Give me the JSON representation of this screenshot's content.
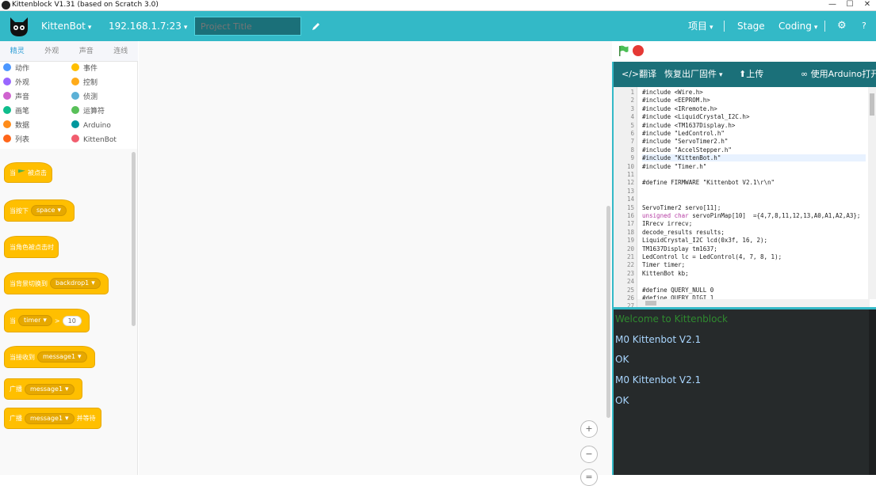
{
  "window": {
    "title": "Kittenblock V1.31 (based on Scratch 3.0)",
    "min": "—",
    "max": "☐",
    "close": "✕"
  },
  "menubar": {
    "brand": "KittenBot",
    "ip": "192.168.1.7:23",
    "project_placeholder": "Project Title",
    "project_menu": "项目",
    "stage": "Stage",
    "coding": "Coding",
    "settings_glyph": "⚙",
    "help_glyph": "?"
  },
  "tabs": [
    "精灵",
    "外观",
    "声音",
    "连线"
  ],
  "categories": [
    {
      "label": "动作",
      "color": "#4c97ff"
    },
    {
      "label": "事件",
      "color": "#ffbf00"
    },
    {
      "label": "外观",
      "color": "#9966ff"
    },
    {
      "label": "控制",
      "color": "#ffab19"
    },
    {
      "label": "声音",
      "color": "#cf63cf"
    },
    {
      "label": "侦测",
      "color": "#5cb1d6"
    },
    {
      "label": "画笔",
      "color": "#0fbd8c"
    },
    {
      "label": "运算符",
      "color": "#59c059"
    },
    {
      "label": "数据",
      "color": "#ff8c1a"
    },
    {
      "label": "Arduino",
      "color": "#00979d"
    },
    {
      "label": "列表",
      "color": "#ff661a"
    },
    {
      "label": "KittenBot",
      "color": "#f15d6e"
    }
  ],
  "blocks": {
    "flag_clicked": {
      "before": "当",
      "after": "被点击"
    },
    "key_pressed": {
      "text": "当按下",
      "key": "space"
    },
    "sprite_clicked": "当角色被点击时",
    "backdrop_switch": {
      "text": "当背景切换到",
      "value": "backdrop1"
    },
    "timer_gt": {
      "text": "当",
      "sensor": "timer",
      "op": ">",
      "value": "10"
    },
    "receive": {
      "text": "当接收到",
      "value": "message1"
    },
    "broadcast": {
      "text": "广播",
      "value": "message1"
    },
    "broadcast_wait": {
      "text": "广播",
      "value": "message1",
      "after": "并等待"
    }
  },
  "workspace": {
    "zoom_in": "+",
    "zoom_out": "−",
    "zoom_reset": "="
  },
  "code_toolbar": {
    "compile": "</>翻译",
    "restore": "恢复出厂固件",
    "upload": "⬆上传",
    "open_arduino": "∞ 使用Arduino打开"
  },
  "code_lines": [
    "#include <Wire.h>",
    "#include <EEPROM.h>",
    "#include <IRremote.h>",
    "#include <LiquidCrystal_I2C.h>",
    "#include <TM1637Display.h>",
    "#include \"LedControl.h\"",
    "#include \"ServoTimer2.h\"",
    "#include \"AccelStepper.h\"",
    "#include \"KittenBot.h\"",
    "#include \"Timer.h\"",
    "",
    "#define FIRMWARE \"Kittenbot V2.1\\r\\n\"",
    "",
    "",
    "ServoTimer2 servo[11];",
    "unsigned char servoPinMap[10]  ={4,7,8,11,12,13,A0,A1,A2,A3};",
    "IRrecv irrecv;",
    "decode_results results;",
    "LiquidCrystal_I2C lcd(0x3f, 16, 2);",
    "TM1637Display tm1637;",
    "LedControl lc = LedControl(4, 7, 8, 1);",
    "Timer timer;",
    "KittenBot kb;",
    "",
    "#define QUERY_NULL 0",
    "#define QUERY_DIGI 1",
    ""
  ],
  "console": [
    {
      "text": "Welcome to Kittenblock",
      "color": "green"
    },
    {
      "text": "M0 Kittenbot V2.1",
      "color": "blue"
    },
    {
      "text": "OK",
      "color": "blue"
    },
    {
      "text": "M0 Kittenbot V2.1",
      "color": "blue"
    },
    {
      "text": "OK",
      "color": "blue"
    }
  ],
  "colors": {
    "accent": "#33b9c7",
    "dark_teal": "#1b7079",
    "block_yellow": "#ffbf00"
  }
}
